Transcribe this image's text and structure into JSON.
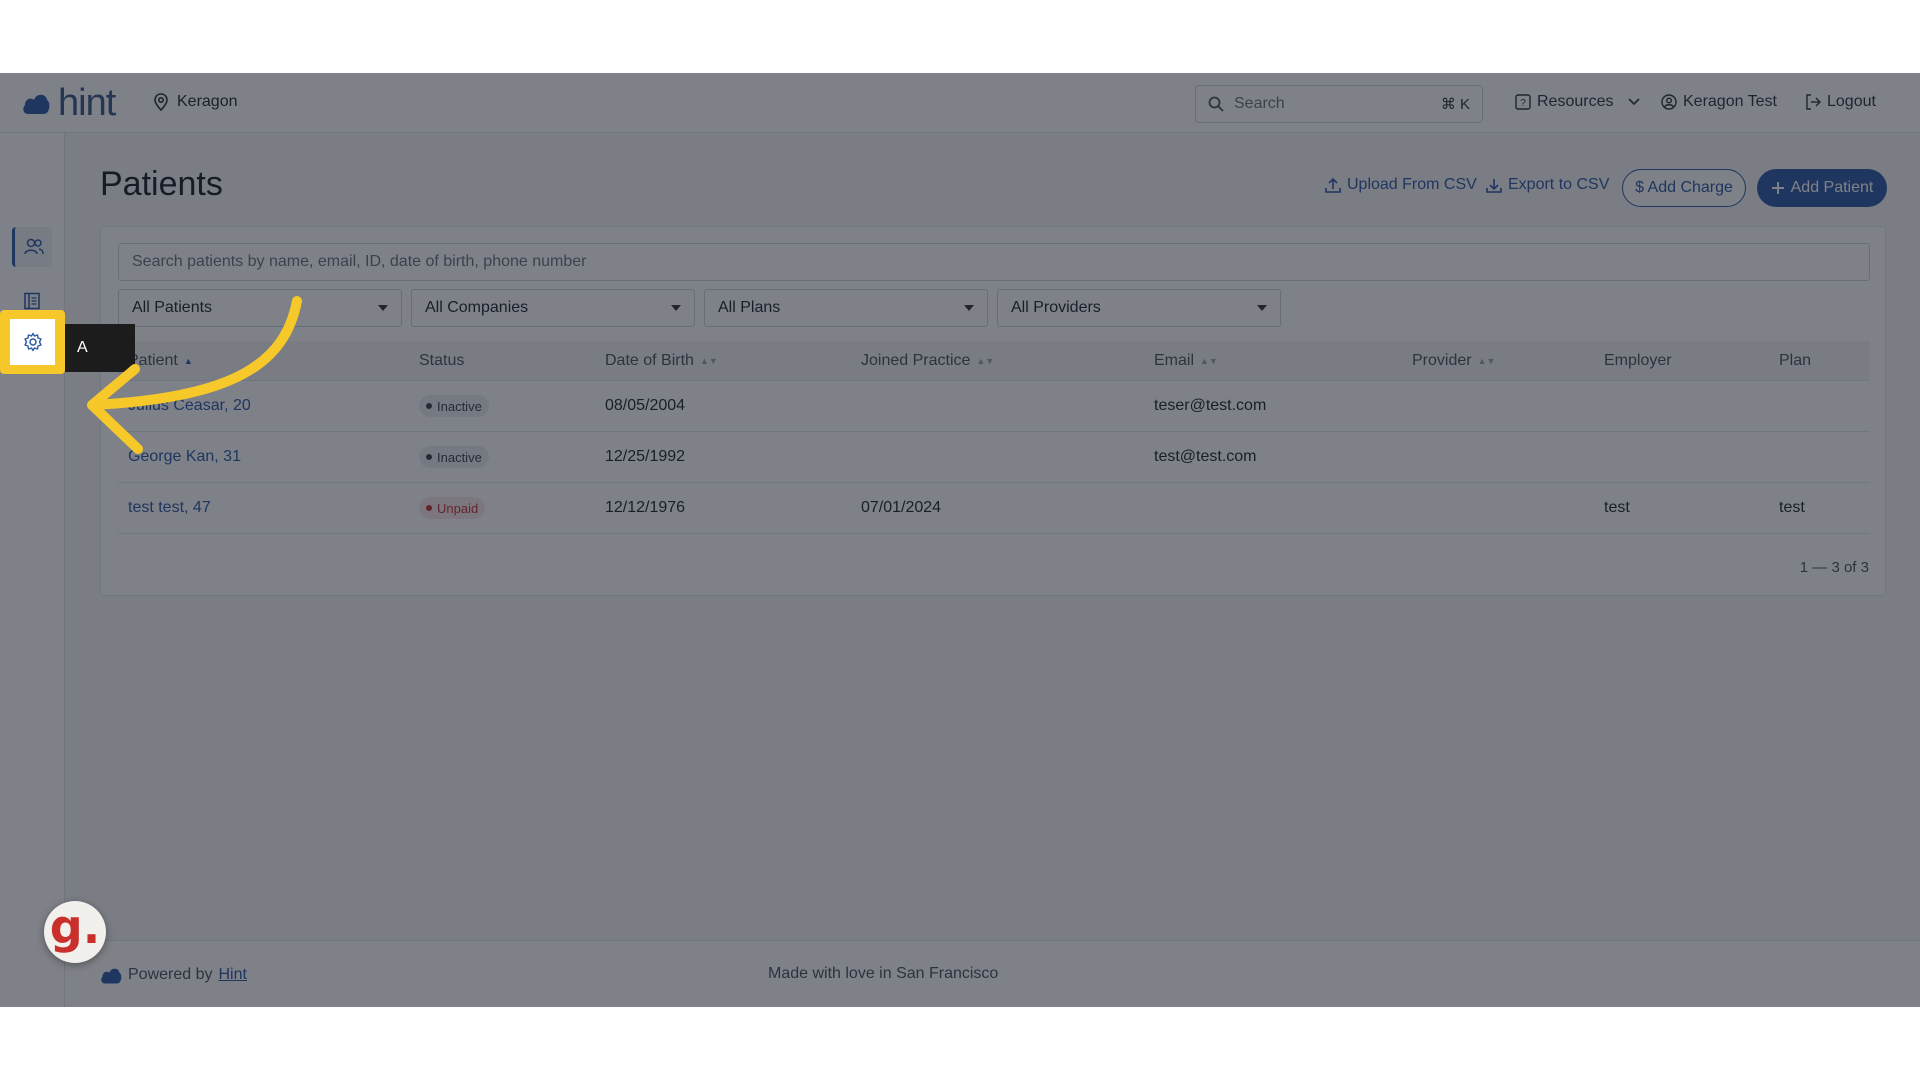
{
  "header": {
    "logo_text": "hint",
    "location": "Keragon",
    "search_placeholder": "Search",
    "search_shortcut": "⌘ K",
    "resources_label": "Resources",
    "user_label": "Keragon Test",
    "logout_label": "Logout"
  },
  "sidebar": {
    "tooltip_label": "A",
    "items": [
      {
        "icon": "users-icon"
      },
      {
        "icon": "ledger-icon"
      },
      {
        "icon": "bar-chart-icon"
      },
      {
        "icon": "gear-icon"
      }
    ]
  },
  "main": {
    "title": "Patients",
    "upload_label": "Upload From CSV",
    "export_label": "Export to CSV",
    "add_charge_label": "$ Add Charge",
    "add_patient_label": "Add Patient",
    "patient_search_placeholder": "Search patients by name, email, ID, date of birth, phone number",
    "filters": [
      "All Patients",
      "All Companies",
      "All Plans",
      "All Providers"
    ],
    "columns": [
      "Patient",
      "Status",
      "Date of Birth",
      "Joined Practice",
      "Email",
      "Provider",
      "Employer",
      "Plan"
    ],
    "rows": [
      {
        "patient": "Julius Ceasar, 20",
        "status": "Inactive",
        "dob": "08/05/2004",
        "joined": "",
        "email": "teser@test.com",
        "provider": "",
        "employer": "",
        "plan": ""
      },
      {
        "patient": "George Kan, 31",
        "status": "Inactive",
        "dob": "12/25/1992",
        "joined": "",
        "email": "test@test.com",
        "provider": "",
        "employer": "",
        "plan": ""
      },
      {
        "patient": "test test, 47",
        "status": "Unpaid",
        "dob": "12/12/1976",
        "joined": "07/01/2024",
        "email": "",
        "provider": "",
        "employer": "test",
        "plan": "test"
      }
    ],
    "pagination": "1 — 3 of 3"
  },
  "footer": {
    "powered_prefix": "Powered by",
    "powered_link": "Hint",
    "made_with": "Made with love in San Francisco"
  },
  "guide_badge": "g.",
  "colors": {
    "accent": "#2e5aa8",
    "highlight": "#f7c82a",
    "unpaid": "#c0323a"
  }
}
